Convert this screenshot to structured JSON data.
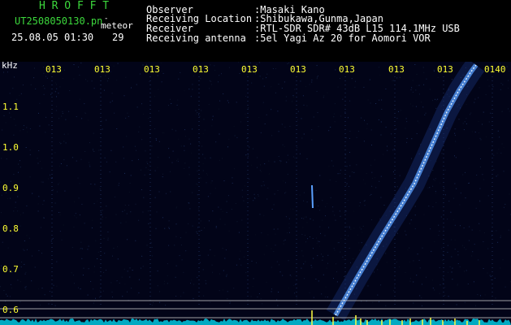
{
  "header": {
    "title": "H R O F F T",
    "filename": "UT2508050130.pn",
    "meteor_label": "meteor",
    "meteor_dash": "-",
    "datetime": "25.08.05 01:30",
    "meteor_count": "29",
    "observer_label": "Observer",
    "observer_value": ":Masaki Kano",
    "location_label": "Receiving Location",
    "location_value": ":Shibukawa,Gunma,Japan",
    "receiver_label": "Receiver",
    "receiver_value": ":RTL-SDR SDR# 43dB L15 114.1MHz USB",
    "antenna_label": "Receiving antenna",
    "antenna_value": ":5el Yagi Az 20 for Aomori VOR"
  },
  "spectrogram": {
    "unit_label": "kHz",
    "time_ticks": [
      "013",
      "013",
      "013",
      "013",
      "013",
      "013",
      "013",
      "013",
      "013",
      "0140"
    ],
    "freq_ticks": [
      "1.1",
      "1.0",
      "0.9",
      "0.8",
      "0.7",
      "0.6"
    ],
    "colors": {
      "background": "#020418",
      "trace": "#5aa0ff",
      "trace_core": "#e8f4ff",
      "baseline": "#00c8e0",
      "bursts": "#ffff40",
      "hlines": "#c8c8c8"
    }
  }
}
